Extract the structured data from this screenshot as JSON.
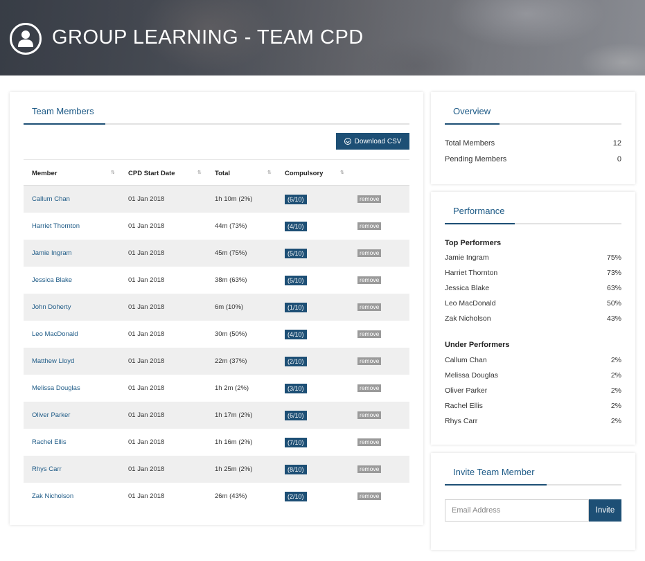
{
  "header": {
    "title": "GROUP LEARNING - TEAM CPD"
  },
  "team": {
    "tab_label": "Team Members",
    "download_label": "Download CSV",
    "columns": [
      "Member",
      "CPD Start Date",
      "Total",
      "Compulsory"
    ],
    "remove_label": "remove",
    "rows": [
      {
        "member": "Callum Chan",
        "date": "01 Jan 2018",
        "total": "1h 10m (2%)",
        "compulsory": "(6/10)"
      },
      {
        "member": "Harriet Thornton",
        "date": "01 Jan 2018",
        "total": "44m (73%)",
        "compulsory": "(4/10)"
      },
      {
        "member": "Jamie Ingram",
        "date": "01 Jan 2018",
        "total": "45m (75%)",
        "compulsory": "(5/10)"
      },
      {
        "member": "Jessica Blake",
        "date": "01 Jan 2018",
        "total": "38m (63%)",
        "compulsory": "(5/10)"
      },
      {
        "member": "John Doherty",
        "date": "01 Jan 2018",
        "total": "6m (10%)",
        "compulsory": "(1/10)"
      },
      {
        "member": "Leo MacDonald",
        "date": "01 Jan 2018",
        "total": "30m (50%)",
        "compulsory": "(4/10)"
      },
      {
        "member": "Matthew Lloyd",
        "date": "01 Jan 2018",
        "total": "22m (37%)",
        "compulsory": "(2/10)"
      },
      {
        "member": "Melissa Douglas",
        "date": "01 Jan 2018",
        "total": "1h 2m (2%)",
        "compulsory": "(3/10)"
      },
      {
        "member": "Oliver Parker",
        "date": "01 Jan 2018",
        "total": "1h 17m (2%)",
        "compulsory": "(6/10)"
      },
      {
        "member": "Rachel Ellis",
        "date": "01 Jan 2018",
        "total": "1h 16m (2%)",
        "compulsory": "(7/10)"
      },
      {
        "member": "Rhys Carr",
        "date": "01 Jan 2018",
        "total": "1h 25m (2%)",
        "compulsory": "(8/10)"
      },
      {
        "member": "Zak Nicholson",
        "date": "01 Jan 2018",
        "total": "26m (43%)",
        "compulsory": "(2/10)"
      }
    ]
  },
  "overview": {
    "tab_label": "Overview",
    "items": [
      {
        "label": "Total Members",
        "value": "12"
      },
      {
        "label": "Pending Members",
        "value": "0"
      }
    ]
  },
  "performance": {
    "tab_label": "Performance",
    "top_heading": "Top Performers",
    "top": [
      {
        "name": "Jamie Ingram",
        "value": "75%"
      },
      {
        "name": "Harriet Thornton",
        "value": "73%"
      },
      {
        "name": "Jessica Blake",
        "value": "63%"
      },
      {
        "name": "Leo MacDonald",
        "value": "50%"
      },
      {
        "name": "Zak Nicholson",
        "value": "43%"
      }
    ],
    "under_heading": "Under Performers",
    "under": [
      {
        "name": "Callum Chan",
        "value": "2%"
      },
      {
        "name": "Melissa Douglas",
        "value": "2%"
      },
      {
        "name": "Oliver Parker",
        "value": "2%"
      },
      {
        "name": "Rachel Ellis",
        "value": "2%"
      },
      {
        "name": "Rhys Carr",
        "value": "2%"
      }
    ]
  },
  "invite": {
    "tab_label": "Invite Team Member",
    "email_placeholder": "Email Address",
    "email_value": "",
    "button_label": "Invite"
  },
  "colors": {
    "accent": "#1d4f75",
    "link": "#1d5a86",
    "remove": "#9a9a9a",
    "row_shade": "#efefef"
  }
}
